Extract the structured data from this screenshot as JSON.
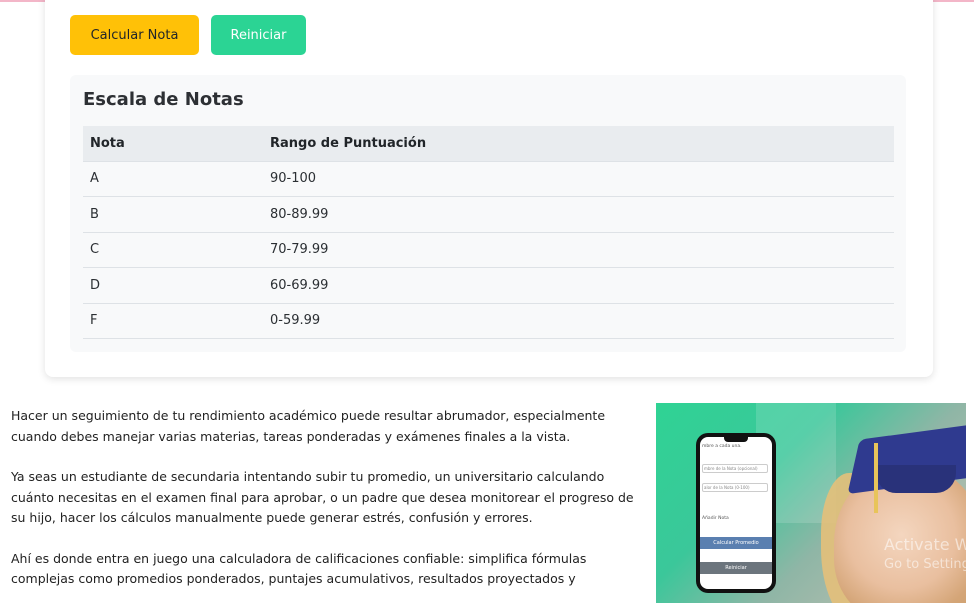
{
  "buttons": {
    "calculate_label": "Calcular Nota",
    "reset_label": "Reiniciar"
  },
  "scale": {
    "title": "Escala de Notas",
    "headers": [
      "Nota",
      "Rango de Puntuación"
    ],
    "rows": [
      {
        "grade": "A",
        "range": "90-100"
      },
      {
        "grade": "B",
        "range": "80-89.99"
      },
      {
        "grade": "C",
        "range": "70-79.99"
      },
      {
        "grade": "D",
        "range": "60-69.99"
      },
      {
        "grade": "F",
        "range": "0-59.99"
      }
    ]
  },
  "article": {
    "p1": "Hacer un seguimiento de tu rendimiento académico puede resultar abrumador, especialmente cuando debes manejar varias materias, tareas ponderadas y exámenes finales a la vista.",
    "p2": "Ya seas un estudiante de secundaria intentando subir tu promedio, un universitario calculando cuánto necesitas en el examen final para aprobar, o un padre que desea monitorear el progreso de su hijo, hacer los cálculos manualmente puede generar estrés, confusión y errores.",
    "p3": "Ahí es donde entra en juego una calculadora de calificaciones confiable: simplifica fórmulas complejas como promedios ponderados, puntajes acumulativos, resultados proyectados y"
  },
  "promo": {
    "phone_lines": [
      "mbre a cada una.",
      "mbre de la Nota (opcional)",
      "alor de la Nota (0-100)",
      "Añadir Nota"
    ],
    "phone_calc_button": "Calcular Promedio",
    "phone_reset_button": "Reiniciar",
    "watermark_line1": "Activate W",
    "watermark_line2": "Go to Setting"
  },
  "colors": {
    "calc_button": "#ffc107",
    "reset_button": "#2bd494",
    "phone_calc": "#5a7fb0",
    "phone_reset": "#6c757d"
  }
}
